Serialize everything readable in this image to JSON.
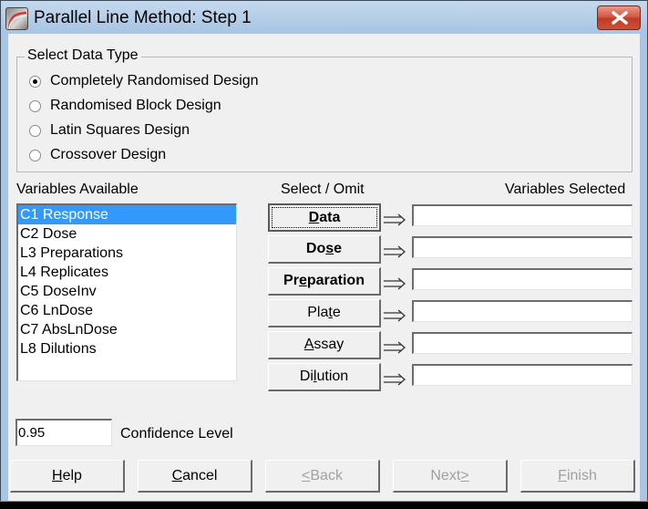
{
  "window": {
    "title": "Parallel Line Method: Step 1",
    "icon": "app-curve-icon",
    "close_icon": "close-icon"
  },
  "data_type": {
    "legend": "Select Data Type",
    "options": [
      {
        "label": "Completely Randomised Design",
        "checked": true
      },
      {
        "label": "Randomised Block Design",
        "checked": false
      },
      {
        "label": "Latin Squares Design",
        "checked": false
      },
      {
        "label": "Crossover Design",
        "checked": false
      }
    ]
  },
  "variables_available": {
    "label": "Variables Available",
    "items": [
      "C1 Response",
      "C2 Dose",
      "L3 Preparations",
      "L4 Replicates",
      "C5 DoseInv",
      "C6 LnDose",
      "C7 AbsLnDose",
      "L8 Dilutions"
    ],
    "selected_index": 0
  },
  "select_omit": {
    "label": "Select / Omit",
    "buttons": [
      {
        "pre": "",
        "ul": "D",
        "post": "ata",
        "bold": true,
        "focused": true
      },
      {
        "pre": "Do",
        "ul": "s",
        "post": "e",
        "bold": true,
        "focused": false
      },
      {
        "pre": "Pr",
        "ul": "e",
        "post": "paration",
        "bold": true,
        "focused": false
      },
      {
        "pre": "Pla",
        "ul": "t",
        "post": "e",
        "bold": false,
        "focused": false
      },
      {
        "pre": "",
        "ul": "A",
        "post": "ssay",
        "bold": false,
        "focused": false
      },
      {
        "pre": "Di",
        "ul": "l",
        "post": "ution",
        "bold": false,
        "focused": false
      }
    ],
    "arrow_icon": "double-arrow-right-icon"
  },
  "variables_selected": {
    "label": "Variables Selected",
    "values": [
      "",
      "",
      "",
      "",
      "",
      ""
    ]
  },
  "confidence": {
    "value": "0.95",
    "label": "Confidence Level"
  },
  "footer": {
    "buttons": [
      {
        "pre": "",
        "ul": "H",
        "post": "elp",
        "disabled": false,
        "name": "help-button"
      },
      {
        "pre": "",
        "ul": "C",
        "post": "ancel",
        "disabled": false,
        "name": "cancel-button"
      },
      {
        "pre": "",
        "ul": "<",
        "post": " Back",
        "disabled": true,
        "name": "back-button"
      },
      {
        "pre": "Next ",
        "ul": ">",
        "post": "",
        "disabled": true,
        "name": "next-button"
      },
      {
        "pre": "",
        "ul": "F",
        "post": "inish",
        "disabled": true,
        "name": "finish-button"
      }
    ]
  }
}
